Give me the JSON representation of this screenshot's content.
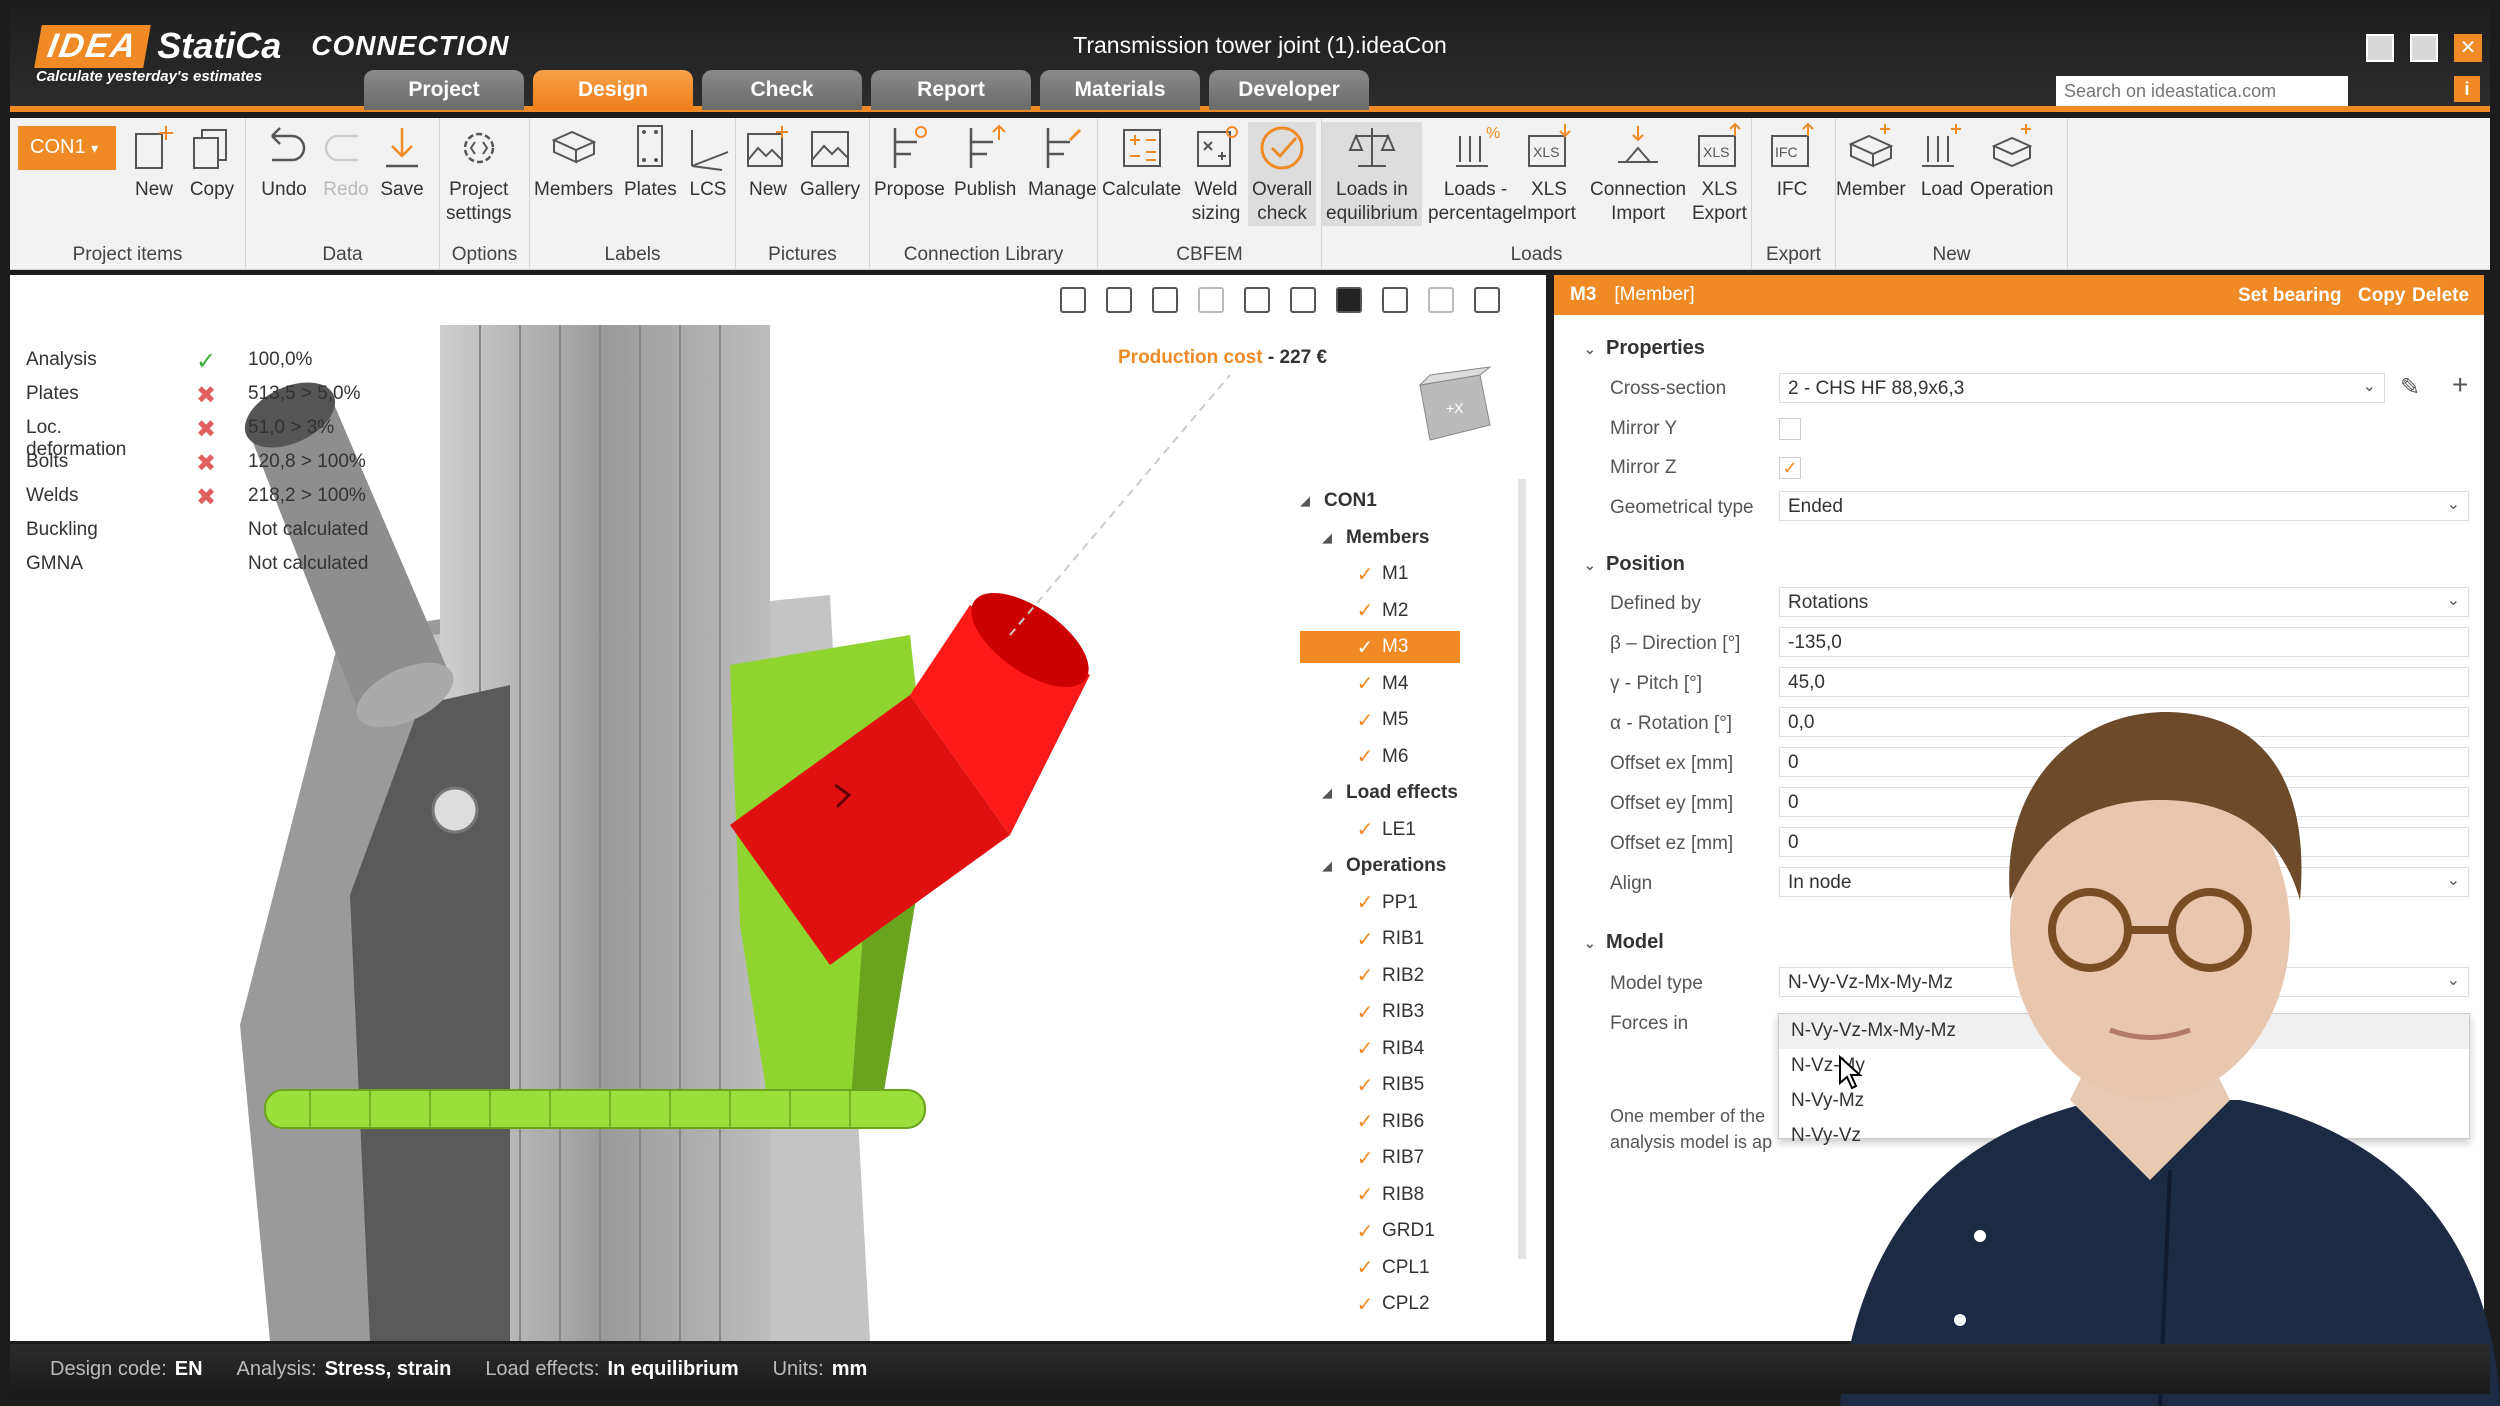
{
  "app": {
    "brand": "IDEA",
    "brand2": "StatiCa",
    "product": "CONNECTION",
    "tagline": "Calculate yesterday's estimates",
    "document_title": "Transmission tower joint (1).ideaCon",
    "search_placeholder": "Search on ideastatica.com",
    "help": "i"
  },
  "tabs": [
    "Project",
    "Design",
    "Check",
    "Report",
    "Materials",
    "Developer"
  ],
  "active_tab": "Design",
  "accent_color": "#f08a24",
  "ribbon": {
    "connection_selector": "CON1",
    "groups": {
      "project_items": {
        "label": "Project items",
        "new": "New",
        "copy": "Copy"
      },
      "data": {
        "label": "Data",
        "undo": "Undo",
        "redo": "Redo",
        "save": "Save"
      },
      "options": {
        "label": "Options",
        "project_settings_1": "Project",
        "project_settings_2": "settings"
      },
      "labels": {
        "label": "Labels",
        "members": "Members",
        "plates": "Plates",
        "lcs": "LCS"
      },
      "pictures": {
        "label": "Pictures",
        "new": "New",
        "gallery": "Gallery"
      },
      "connection_library": {
        "label": "Connection Library",
        "propose": "Propose",
        "publish": "Publish",
        "manage": "Manage"
      },
      "cbfem": {
        "label": "CBFEM",
        "calculate": "Calculate",
        "weld_sizing_1": "Weld",
        "weld_sizing_2": "sizing",
        "overall_check_1": "Overall",
        "overall_check_2": "check"
      },
      "loads": {
        "label": "Loads",
        "loads_in_eq_1": "Loads in",
        "loads_in_eq_2": "equilibrium",
        "loads_pct_1": "Loads -",
        "loads_pct_2": "percentage",
        "xls_import_1": "XLS",
        "xls_import_2": "Import",
        "conn_import_1": "Connection",
        "conn_import_2": "Import",
        "xls_export_1": "XLS",
        "xls_export_2": "Export"
      },
      "export": {
        "label": "Export",
        "ifc": "IFC"
      },
      "new": {
        "label": "New",
        "member": "Member",
        "load": "Load",
        "operation": "Operation"
      }
    }
  },
  "status": [
    {
      "label": "Analysis",
      "state": "ok",
      "value": "100,0%"
    },
    {
      "label": "Plates",
      "state": "fail",
      "value": "513,5 > 5,0%"
    },
    {
      "label": "Loc. deformation",
      "state": "fail",
      "value": "51,0 > 3%"
    },
    {
      "label": "Bolts",
      "state": "fail",
      "value": "120,8 > 100%"
    },
    {
      "label": "Welds",
      "state": "fail",
      "value": "218,2 > 100%"
    },
    {
      "label": "Buckling",
      "state": "none",
      "value": "Not calculated"
    },
    {
      "label": "GMNA",
      "state": "none",
      "value": "Not calculated"
    }
  ],
  "production_cost": {
    "label": "Production cost",
    "sep": "-",
    "value": "227 €"
  },
  "tree": {
    "root": "CON1",
    "members_label": "Members",
    "members": [
      "M1",
      "M2",
      "M3",
      "M4",
      "M5",
      "M6"
    ],
    "selected_member": "M3",
    "load_effects_label": "Load effects",
    "load_effects": [
      "LE1"
    ],
    "operations_label": "Operations",
    "operations": [
      "PP1",
      "RIB1",
      "RIB2",
      "RIB3",
      "RIB4",
      "RIB5",
      "RIB6",
      "RIB7",
      "RIB8",
      "GRD1",
      "CPL1",
      "CPL2"
    ]
  },
  "panel": {
    "title": "M3",
    "subtitle": "[Member]",
    "actions": {
      "set_bearing": "Set bearing",
      "copy": "Copy",
      "delete": "Delete"
    },
    "properties": {
      "section": "Properties",
      "cross_section_label": "Cross-section",
      "cross_section": "2 - CHS HF 88,9x6,3",
      "mirror_y_label": "Mirror Y",
      "mirror_y": false,
      "mirror_z_label": "Mirror Z",
      "mirror_z": true,
      "geometrical_type_label": "Geometrical type",
      "geometrical_type": "Ended"
    },
    "position": {
      "section": "Position",
      "defined_by_label": "Defined by",
      "defined_by": "Rotations",
      "beta_label": "β – Direction [°]",
      "beta": "-135,0",
      "gamma_label": "γ - Pitch [°]",
      "gamma": "45,0",
      "alpha_label": "α - Rotation [°]",
      "alpha": "0,0",
      "ex_label": "Offset ex [mm]",
      "ex": "0",
      "ey_label": "Offset ey [mm]",
      "ey": "0",
      "ez_label": "Offset ez [mm]",
      "ez": "0",
      "align_label": "Align",
      "align": "In node"
    },
    "model": {
      "section": "Model",
      "model_type_label": "Model type",
      "model_type": "N-Vy-Vz-Mx-My-Mz",
      "forces_in_label": "Forces in",
      "options": [
        "N-Vy-Vz-Mx-My-Mz",
        "N-Vz-My",
        "N-Vy-Mz",
        "N-Vy-Vz"
      ],
      "note_1": "One member of the",
      "note_2": "analysis model is ap"
    }
  },
  "bottom": {
    "design_code_label": "Design code:",
    "design_code": "EN",
    "analysis_label": "Analysis:",
    "analysis": "Stress, strain",
    "load_effects_label": "Load effects:",
    "load_effects": "In equilibrium",
    "units_label": "Units:",
    "units": "mm"
  }
}
